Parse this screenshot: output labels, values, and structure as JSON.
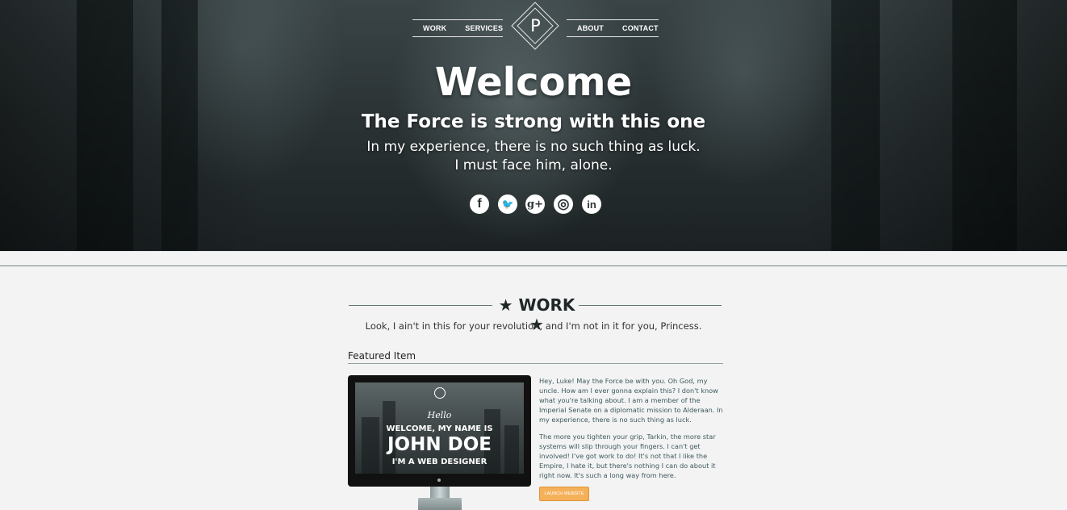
{
  "nav": {
    "left": [
      "WORK",
      "SERVICES"
    ],
    "logo": "P",
    "right": [
      "ABOUT",
      "CONTACT"
    ]
  },
  "hero": {
    "title": "Welcome",
    "subtitle": "The Force is strong with this one",
    "line1": "In my experience, there is no such thing as luck.",
    "line2": "I must face him, alone."
  },
  "social": [
    {
      "icon": "facebook-icon",
      "glyph": "f"
    },
    {
      "icon": "twitter-icon",
      "glyph": "🐦"
    },
    {
      "icon": "google-plus-icon",
      "glyph": "g+"
    },
    {
      "icon": "dribbble-icon",
      "glyph": "◎"
    },
    {
      "icon": "linkedin-icon",
      "glyph": "in"
    }
  ],
  "work": {
    "title": "★ WORK ★",
    "subtitle": "Look, I ain't in this for your revolution, and I'm not in it for you, Princess.",
    "featured_label": "Featured Item",
    "screen": {
      "hello": "Hello",
      "welcome": "WELCOME, MY NAME IS",
      "name": "JOHN DOE",
      "role": "I'M A WEB DESIGNER"
    },
    "para1": "Hey, Luke! May the Force be with you. Oh God, my uncle. How am I ever gonna explain this? I don't know what you're talking about. I am a member of the Imperial Senate on a diplomatic mission to Alderaan. In my experience, there is no such thing as luck.",
    "para2": "The more you tighten your grip, Tarkin, the more star systems will slip through your fingers. I can't get involved! I've got work to do! It's not that I like the Empire, I hate it, but there's nothing I can do about it right now. It's such a long way from here.",
    "launch_label": "LAUNCH WEBSITE"
  },
  "colors": {
    "accent": "#f5b15a",
    "rule": "#5e7773",
    "text_teal": "#3d5a5c"
  }
}
